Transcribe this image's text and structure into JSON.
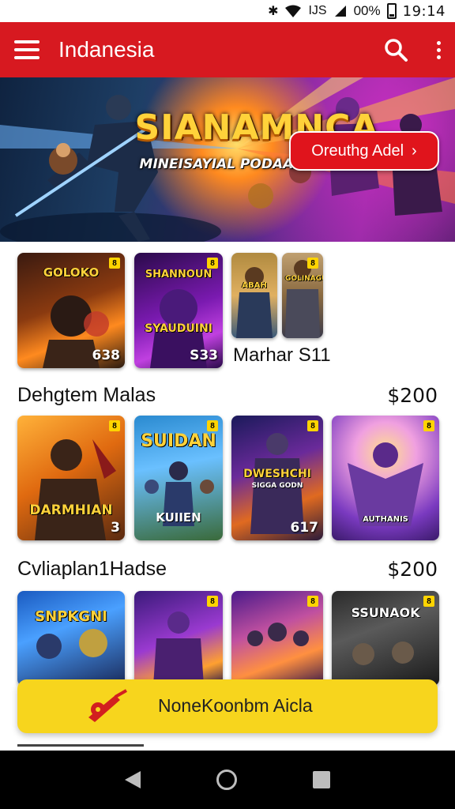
{
  "status_bar": {
    "icons": [
      "bluetooth-icon",
      "wifi-icon",
      "signal-icon"
    ],
    "network": "IJS",
    "battery": "00%",
    "time": "19:14"
  },
  "app_bar": {
    "title": "Indanesia",
    "icons": [
      "menu-icon",
      "search-icon",
      "more-vertical-icon"
    ],
    "color": "#d71920"
  },
  "banner": {
    "title": "SIANAMNCA",
    "subtitle": "MINEISAYIAL PODAAK PEBNISIM",
    "button_label": "Oreuthg Adel",
    "button_icon": "chevron-right-icon"
  },
  "row1": {
    "tiles": [
      {
        "title": "GOLOKO",
        "number": "638"
      },
      {
        "title": "SHANNOUN",
        "subtitle": "SYAUDUINI",
        "number": "S33"
      },
      {
        "title": "ABAH"
      },
      {
        "title": "GOLINAGUN"
      }
    ],
    "caption": "Marhar S11"
  },
  "section1": {
    "title": "Dehgtem Malas",
    "price": "$200",
    "tiles": [
      {
        "title": "DARMHIAN",
        "number": "3"
      },
      {
        "title": "SUIDAN",
        "subtitle": "KUIIEN"
      },
      {
        "title": "DWESHCHI",
        "subtitle": "SIGGA GODN",
        "number": "617"
      },
      {
        "title": "AUTHANIS"
      }
    ]
  },
  "section2": {
    "title": "Cvliaplan1Hadse",
    "price": "$200",
    "tiles": [
      {
        "title": "SNPKGNI"
      },
      {
        "title": ""
      },
      {
        "title": ""
      },
      {
        "title": "SSUNAOK"
      }
    ]
  },
  "cta": {
    "label": "NoneKoonbm Aicla",
    "icon": "guitar-icon",
    "color": "#f7d51d"
  },
  "nav_bar": {
    "icons": [
      "back-icon",
      "home-icon",
      "recents-icon"
    ]
  }
}
